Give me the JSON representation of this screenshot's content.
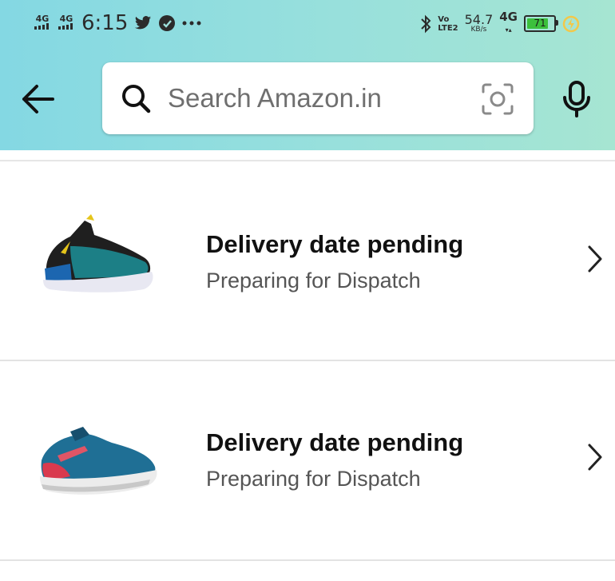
{
  "status_bar": {
    "signal1": "4G",
    "signal2": "4G",
    "time": "6:15",
    "volte_top": "Vo",
    "volte_bottom": "LTE2",
    "speed_value": "54.7",
    "speed_unit": "KB/s",
    "network": "4G",
    "battery_level": "71",
    "battery_fraction": 0.71,
    "icons": [
      "twitter-icon",
      "app-icon",
      "more-icon",
      "bluetooth-icon",
      "battery-saver-icon"
    ]
  },
  "header": {
    "search_placeholder": "Search Amazon.in",
    "colors": {
      "gradient_start": "#84d8e3",
      "gradient_end": "#a6e5d2"
    }
  },
  "orders": [
    {
      "title": "Delivery date pending",
      "subtitle": "Preparing for Dispatch",
      "image": "teal-black-sports-shoe"
    },
    {
      "title": "Delivery date pending",
      "subtitle": "Preparing for Dispatch",
      "image": "blue-red-running-shoe"
    }
  ]
}
